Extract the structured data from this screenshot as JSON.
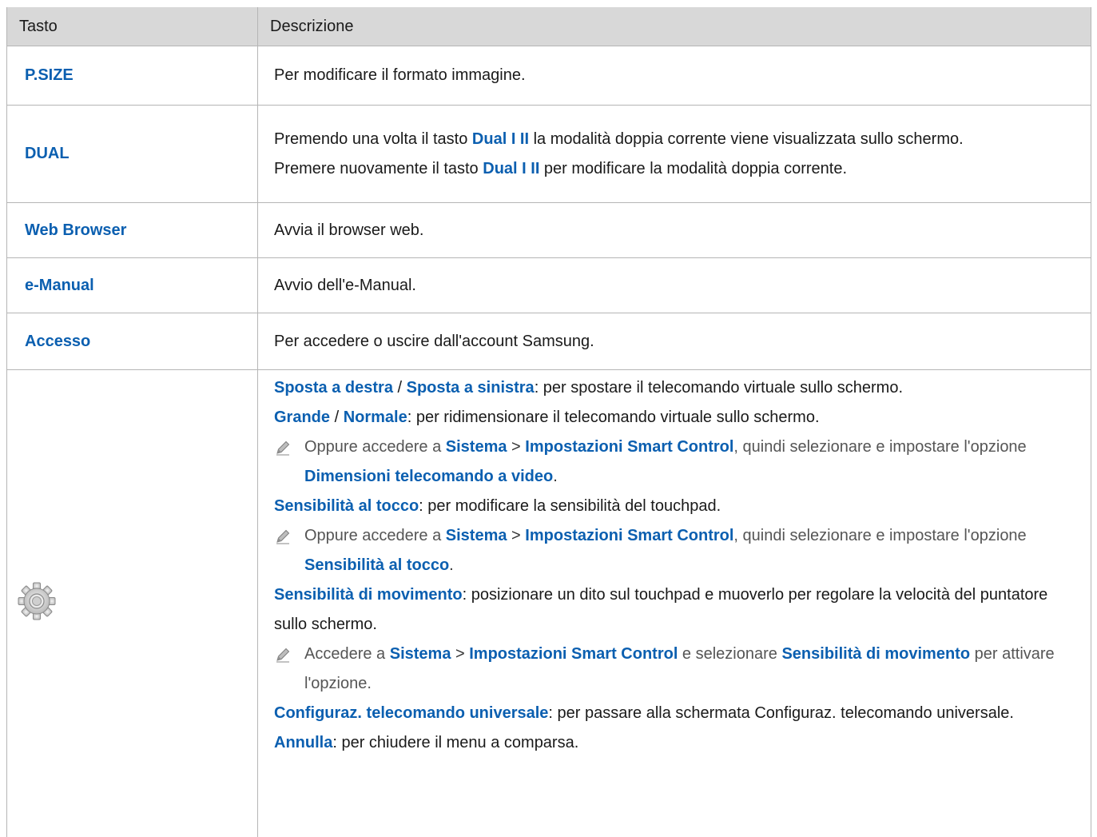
{
  "table": {
    "header": {
      "col1": "Tasto",
      "col2": "Descrizione"
    },
    "rows": [
      {
        "key": "P.SIZE",
        "desc": "Per modificare il formato immagine."
      },
      {
        "key": "DUAL",
        "desc_a": "Premendo una volta il tasto ",
        "desc_b": "Dual I II",
        "desc_c": " la modalità doppia corrente viene visualizzata sullo schermo.",
        "desc_d": "Premere nuovamente il tasto ",
        "desc_e": "Dual I II",
        "desc_f": " per modificare la modalità doppia corrente."
      },
      {
        "key": "Web Browser",
        "desc": "Avvia il browser web."
      },
      {
        "key": "e-Manual",
        "desc": "Avvio dell'e-Manual."
      },
      {
        "key": "Accesso",
        "desc": "Per accedere o uscire dall'account Samsung."
      }
    ],
    "gear_row": {
      "icon": "gear-icon",
      "l1_a": "Sposta a destra",
      "l1_b": " / ",
      "l1_c": "Sposta a sinistra",
      "l1_d": ": per spostare il telecomando virtuale sullo schermo.",
      "l2_a": "Grande",
      "l2_b": " / ",
      "l2_c": "Normale",
      "l2_d": ": per ridimensionare il telecomando virtuale sullo schermo.",
      "n1_a": "Oppure accedere a ",
      "n1_b": "Sistema",
      "n1_c": " > ",
      "n1_d": "Impostazioni Smart Control",
      "n1_e": ", quindi selezionare e impostare l'opzione ",
      "n1_f": "Dimensioni telecomando a video",
      "n1_g": ".",
      "l3_a": "Sensibilità al tocco",
      "l3_b": ": per modificare la sensibilità del touchpad.",
      "n2_a": "Oppure accedere a ",
      "n2_b": "Sistema",
      "n2_c": " > ",
      "n2_d": "Impostazioni Smart Control",
      "n2_e": ", quindi selezionare e impostare l'opzione ",
      "n2_f": "Sensibilità al tocco",
      "n2_g": ".",
      "l4_a": "Sensibilità di movimento",
      "l4_b": ": posizionare un dito sul touchpad e muoverlo per regolare la velocità del puntatore sullo schermo.",
      "n3_a": "Accedere a ",
      "n3_b": "Sistema",
      "n3_c": " > ",
      "n3_d": "Impostazioni Smart Control",
      "n3_e": " e selezionare ",
      "n3_f": "Sensibilità di movimento",
      "n3_g": " per attivare l'opzione.",
      "l5_a": "Configuraz. telecomando universale",
      "l5_b": ": per passare alla schermata Configuraz. telecomando universale.",
      "l6_a": "Annulla",
      "l6_b": ": per chiudere il menu a comparsa."
    }
  },
  "colors": {
    "accent": "#0b5fb0",
    "header_bg": "#d8d8d8",
    "border": "#b5b5b5"
  }
}
